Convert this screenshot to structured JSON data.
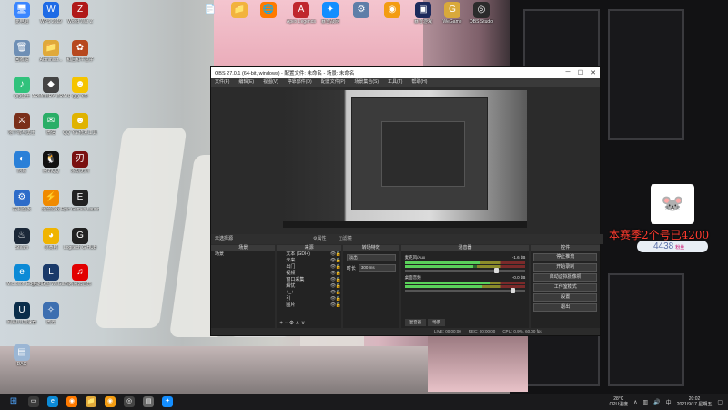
{
  "desktop_icons": [
    {
      "label": "此电脑",
      "glyph": "🖥",
      "color": "#3a86ff",
      "icon": "computer-icon"
    },
    {
      "label": "WPS 2019",
      "glyph": "W",
      "color": "#1e6be6",
      "icon": "wps-icon"
    },
    {
      "label": "World War Z",
      "glyph": "Z",
      "color": "#b01919",
      "icon": "worldwarz-icon"
    },
    {
      "label": "",
      "glyph": "📄",
      "color": "transparent",
      "icon": "file-icon"
    },
    {
      "label": "",
      "glyph": "📁",
      "color": "#f2b33d",
      "icon": "folder-icon"
    },
    {
      "label": "",
      "glyph": "🌐",
      "color": "#ff7a00",
      "icon": "browser-icon"
    },
    {
      "label": "Apex Legends",
      "glyph": "A",
      "color": "#c0272d",
      "icon": "apex-icon"
    },
    {
      "label": "暴雪战网",
      "glyph": "✦",
      "color": "#148eff",
      "icon": "battlenet-icon"
    },
    {
      "label": "",
      "glyph": "⚙",
      "color": "#5f7ea8",
      "icon": "app-icon"
    },
    {
      "label": "",
      "glyph": "◉",
      "color": "#f39c12",
      "icon": "overwatch-icon"
    },
    {
      "label": "暴雪游戏",
      "glyph": "▣",
      "color": "#1d2a5c",
      "icon": "game-icon"
    },
    {
      "label": "WeGame",
      "glyph": "G",
      "color": "#d8a93b",
      "icon": "wegame-icon"
    },
    {
      "label": "OBS Studio",
      "glyph": "◎",
      "color": "#2b2b2b",
      "icon": "obs-icon"
    },
    {
      "label": "回收站",
      "glyph": "🗑",
      "color": "#6e8fb5",
      "icon": "recycle-bin-icon"
    },
    {
      "label": "Administr...",
      "glyph": "📁",
      "color": "#e0a93a",
      "icon": "folder-icon"
    },
    {
      "label": "和后和平盒子",
      "glyph": "✿",
      "color": "#b7481e",
      "icon": "box-icon"
    },
    {
      "label": "QQ音乐",
      "glyph": "♪",
      "color": "#31c27c",
      "icon": "qqmusic-icon"
    },
    {
      "label": "ARMOURY CRATE",
      "glyph": "◆",
      "color": "#444",
      "icon": "armoury-icon"
    },
    {
      "label": "QQ飞车",
      "glyph": "☻",
      "color": "#f5c400",
      "icon": "qqspeed-icon"
    },
    {
      "label": "地下城与勇士",
      "glyph": "⚔",
      "color": "#7a2f1a",
      "icon": "dnf-icon"
    },
    {
      "label": "微信",
      "glyph": "✉",
      "color": "#2aae67",
      "icon": "wechat-icon"
    },
    {
      "label": "QQ飞车修复工具",
      "glyph": "☻",
      "color": "#e0b300",
      "icon": "qqspeed-tool-icon"
    },
    {
      "label": "网易",
      "glyph": "◐",
      "color": "#2a80d8",
      "icon": "netease-icon"
    },
    {
      "label": "腾讯QQ",
      "glyph": "🐧",
      "color": "#111",
      "icon": "qq-icon"
    },
    {
      "label": "永劫无间",
      "glyph": "刃",
      "color": "#7a1010",
      "icon": "naraka-icon"
    },
    {
      "label": "控制面板",
      "glyph": "⚙",
      "color": "#2e6cc9",
      "icon": "control-panel-icon"
    },
    {
      "label": "迅雷游戏",
      "glyph": "⚡",
      "color": "#f08a00",
      "icon": "thunder-icon"
    },
    {
      "label": "Epic Games Launcher",
      "glyph": "E",
      "color": "#222",
      "icon": "epic-icon"
    },
    {
      "label": "Steam",
      "glyph": "♨",
      "color": "#1b2838",
      "icon": "steam-icon"
    },
    {
      "label": "小黄鸭",
      "glyph": "◕",
      "color": "#f0b400",
      "icon": "duck-icon"
    },
    {
      "label": "Logitech G HUB",
      "glyph": "G",
      "color": "#222",
      "icon": "ghub-icon"
    },
    {
      "label": "Microsoft Edge",
      "glyph": "e",
      "color": "#0c8ad6",
      "icon": "edge-icon"
    },
    {
      "label": "英雄联盟 WeGame版",
      "glyph": "L",
      "color": "#1a3a6a",
      "icon": "lol-icon"
    },
    {
      "label": "网易云音乐",
      "glyph": "♫",
      "color": "#e20000",
      "icon": "cloudmusic-icon"
    },
    {
      "label": "网易UU加速器",
      "glyph": "U",
      "color": "#0a2d4a",
      "icon": "uu-icon"
    },
    {
      "label": "微光",
      "glyph": "✧",
      "color": "#3d6fb0",
      "icon": "weiguang-icon"
    },
    {
      "label": "DAG",
      "glyph": "▤",
      "color": "#9bb6d4",
      "icon": "file-icon"
    }
  ],
  "obs": {
    "title": "OBS 27.0.1 (64-bit, windows) - 配置文件: 未命名 - 场景: 未命名",
    "minimize": "─",
    "maximize": "☐",
    "close": "✕",
    "menu": [
      "文件(F)",
      "编辑(E)",
      "视图(V)",
      "停靠部件(D)",
      "配置文件(P)",
      "场景集合(S)",
      "工具(T)",
      "帮助(H)"
    ],
    "toolbar_label": "未选择源",
    "properties_label": "⚙属性",
    "filters_label": "◫滤镜",
    "docks": {
      "scenes": "场景",
      "sources": "来源",
      "filters": "转场特效",
      "mixer": "混音器",
      "controls": "控件"
    },
    "scenes": [
      "场景"
    ],
    "sources": [
      "文本 (GDI+)",
      "未来",
      "出门",
      "视频",
      "窗口采集",
      "解忧",
      "+_+",
      "引",
      "图片"
    ],
    "transition": {
      "type_label": "淡出",
      "duration_label": "时长",
      "duration_value": "300 ms"
    },
    "mixer": [
      {
        "name": "麦克风/Aux",
        "db": "-1.6 dB",
        "level": 0.62,
        "volume": 0.78
      },
      {
        "name": "桌面音频",
        "db": "-0.0 dB",
        "level": 0.7,
        "volume": 0.92
      }
    ],
    "mixer_tabs": [
      "混音器",
      "场景"
    ],
    "controls": [
      "停止推流",
      "开始录制",
      "启动虚拟摄像机",
      "工作室模式",
      "设置",
      "退出"
    ],
    "status": {
      "live": "LIVE: 00:00:00",
      "rec": "REC: 00:00:00",
      "cpu": "CPU: 0.9%, 60.00 fps"
    }
  },
  "overlay": {
    "sticker": "🐭",
    "danmaku": "本赛季2个号已4200",
    "pill_value": "4438",
    "pill_tag": "粉丝"
  },
  "taskbar": {
    "start_icon": "windows-start-icon",
    "apps": [
      {
        "glyph": "▭",
        "color": "#3a3a3a",
        "icon": "taskview-icon"
      },
      {
        "glyph": "e",
        "color": "#0c8ad6",
        "icon": "edge-icon"
      },
      {
        "glyph": "◉",
        "color": "#ff7a00",
        "icon": "browser-icon"
      },
      {
        "glyph": "📁",
        "color": "#e0a93a",
        "icon": "explorer-icon"
      },
      {
        "glyph": "◉",
        "color": "#f39c12",
        "icon": "overwatch-icon"
      },
      {
        "glyph": "◎",
        "color": "#444",
        "icon": "obs-icon"
      },
      {
        "glyph": "▤",
        "color": "#666",
        "icon": "app-icon"
      },
      {
        "glyph": "✦",
        "color": "#148eff",
        "icon": "battlenet-icon"
      }
    ],
    "weather_temp": "28°C",
    "weather_label": "CPU温度",
    "time": "20:02",
    "date": "2021/9/17 星期五"
  }
}
